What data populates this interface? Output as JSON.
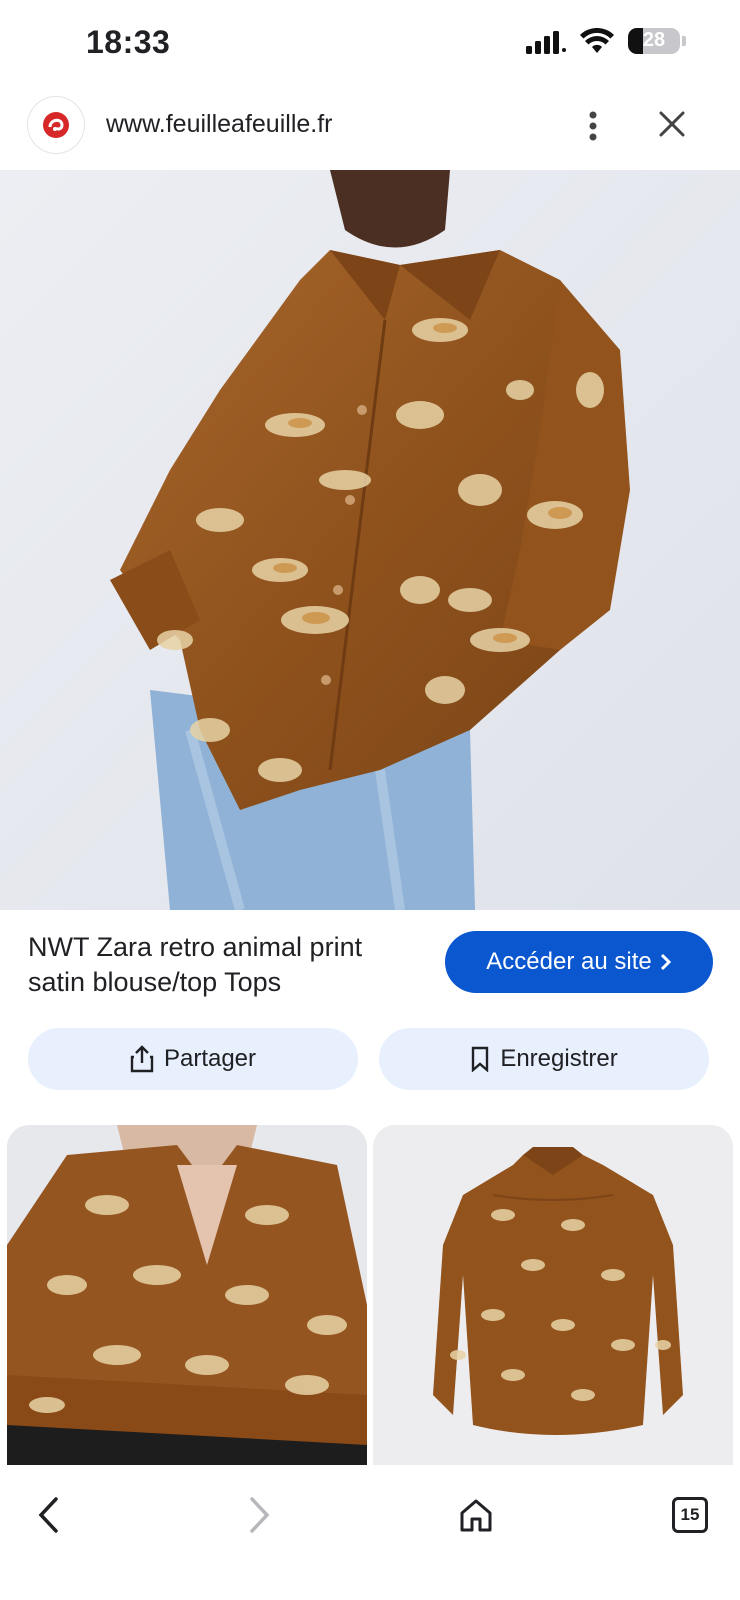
{
  "status": {
    "time": "18:33",
    "battery": "28",
    "battery_level": 0.28
  },
  "browser": {
    "url": "www.feuilleafeuille.fr",
    "tab_count": "15"
  },
  "product": {
    "title": "NWT Zara retro animal print satin blouse/top Tops",
    "visit_label": "Accéder au site",
    "share_label": "Partager",
    "save_label": "Enregistrer"
  },
  "colors": {
    "accent": "#0b57d0",
    "pill": "#e8f0fe",
    "shirt": "#9a5a22",
    "denim": "#8fb2d6",
    "backdrop": "#e6e8ef"
  },
  "icons": [
    "cellular-signal-icon",
    "wifi-icon",
    "battery-icon",
    "site-favicon",
    "more-vert-icon",
    "close-icon",
    "chevron-right-icon",
    "share-icon",
    "bookmark-icon",
    "back-arrow-icon",
    "forward-arrow-icon",
    "home-icon",
    "tabs-icon"
  ]
}
